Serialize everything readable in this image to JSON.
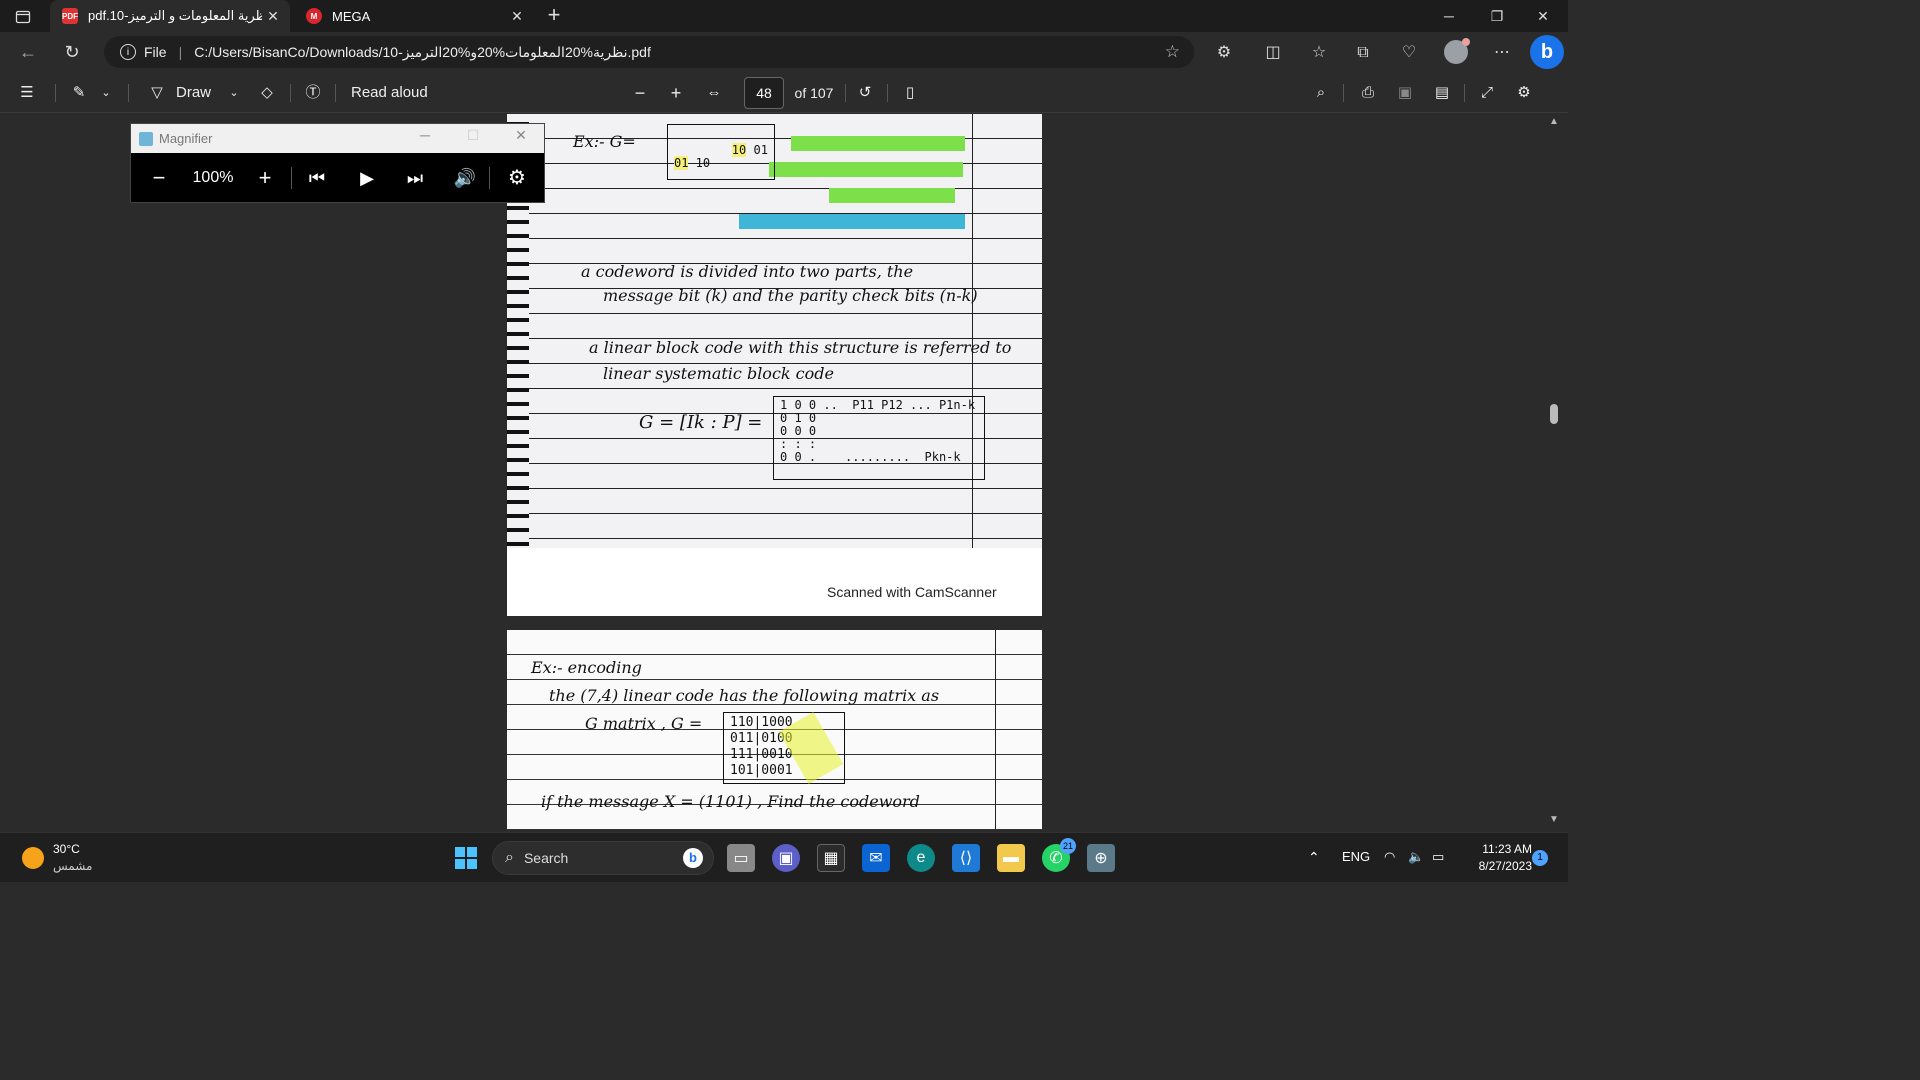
{
  "tabs": [
    {
      "title": "pdf.10-نظرية المعلومات و الترميز",
      "favicon": "PDF",
      "active": true
    },
    {
      "title": "MEGA",
      "favicon": "M",
      "active": false
    }
  ],
  "address": {
    "scheme_label": "File",
    "url": "C:/Users/BisanCo/Downloads/10-نظرية%20المعلومات%20و%20الترميز.pdf"
  },
  "pdf_toolbar": {
    "draw_label": "Draw",
    "read_aloud_label": "Read aloud",
    "page_current": "48",
    "page_total": "of 107"
  },
  "magnifier": {
    "title": "Magnifier",
    "zoom": "100%"
  },
  "page1": {
    "ex_label": "Ex:- G=",
    "line1": "a codeword is divided into two parts, the",
    "line2": "message bit (k) and the parity check bits (n-k)",
    "line3": "a linear block code with this structure is referred to",
    "line4": "linear systematic block code",
    "matrix_eq": "G = [Ik : P] =",
    "footer": "Scanned with CamScanner"
  },
  "page2": {
    "line1": "Ex:- encoding",
    "line2": "the (7,4) linear code has the following matrix as",
    "line3": "G matrix ,  G =",
    "line4": "if the message  X = (1101) , Find the codeword",
    "matrix": "110|1000\n011|0100\n111|0010\n101|0001"
  },
  "taskbar": {
    "temperature": "30°C",
    "weather": "مشمس",
    "search_label": "Search",
    "whatsapp_badge": "21",
    "lang": "ENG",
    "time": "11:23 AM",
    "date": "8/27/2023",
    "notification_count": "1"
  }
}
